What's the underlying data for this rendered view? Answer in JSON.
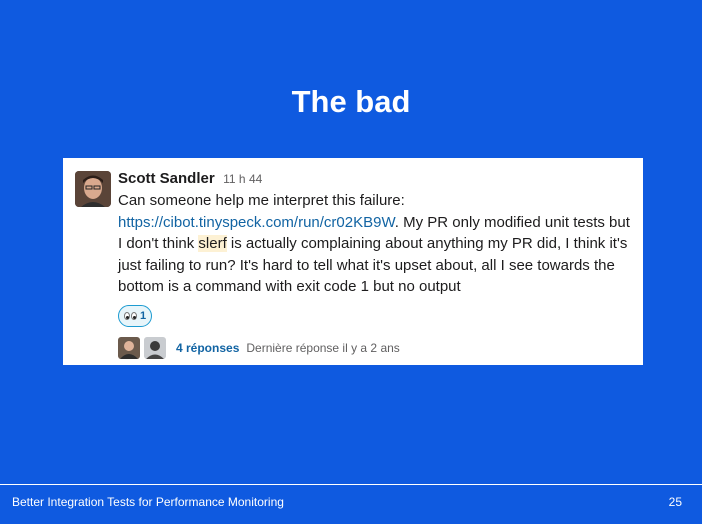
{
  "slide": {
    "title": "The bad",
    "footer": "Better Integration Tests for Performance Monitoring",
    "page_number": "25"
  },
  "message": {
    "author": "Scott Sandler",
    "time": "11 h 44",
    "line1": "Can someone help me interpret this failure:",
    "link": "https://cibot.tinyspeck.com/run/cr02KB9W",
    "text_after_link": ". My PR only modified unit tests but I don't think ",
    "highlight": "slerf",
    "text_after_highlight": " is actually complaining about anything my PR did, I think it's just failing to run? It's hard to tell what it's upset about, all I see towards the bottom is a command with exit code 1 but no output",
    "reaction": {
      "icon": "eyes-emoji-icon",
      "count": "1"
    },
    "thread": {
      "replies": "4 réponses",
      "last_reply": "Dernière réponse il y a 2 ans"
    }
  },
  "colors": {
    "background": "#0f5ae0",
    "link": "#1264a3",
    "highlight": "#fdf1d4"
  }
}
